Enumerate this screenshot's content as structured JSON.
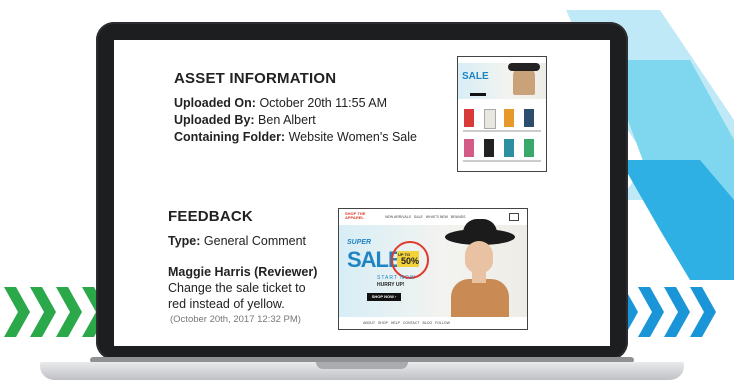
{
  "colors": {
    "chevron_green": "#2aa84a",
    "chevron_blue": "#1a96d8",
    "chevron_light": "#5ed0ee",
    "sale_red": "#e03a2c",
    "sale_blue": "#1f84c4",
    "badge_yellow": "#f3d23c"
  },
  "asset_info": {
    "heading": "ASSET INFORMATION",
    "uploaded_on_label": "Uploaded On:",
    "uploaded_on_value": "October 20th 11:55 AM",
    "uploaded_by_label": "Uploaded By:",
    "uploaded_by_value": "Ben Albert",
    "folder_label": "Containing Folder:",
    "folder_value": "Website Women's Sale"
  },
  "feedback": {
    "heading": "FEEDBACK",
    "type_label": "Type:",
    "type_value": "General Comment",
    "reviewer": "Maggie Harris (Reviewer)",
    "comment_line1": "Change the sale ticket to",
    "comment_line2": "red instead of yellow.",
    "timestamp": "(October 20th, 2017 12:32 PM)"
  },
  "preview": {
    "brand_line1": "SHOP THE",
    "brand_line2": "APPAREL",
    "nav_items": [
      "NEW ARRIVALS",
      "SALE",
      "WHAT'S NEW",
      "BRANDS"
    ],
    "super": "SUPER",
    "sale": "SALE",
    "badge_up_to": "UP TO",
    "badge_pct": "50%",
    "start_now": "START NOW",
    "hurry": "HURRY UP!",
    "shop_now": "SHOP NOW ›",
    "footer_items": [
      "ABOUT",
      "SHOP",
      "HELP",
      "CONTACT",
      "BLOG",
      "FOLLOW"
    ]
  },
  "thumbnail": {
    "sale": "SALE"
  }
}
